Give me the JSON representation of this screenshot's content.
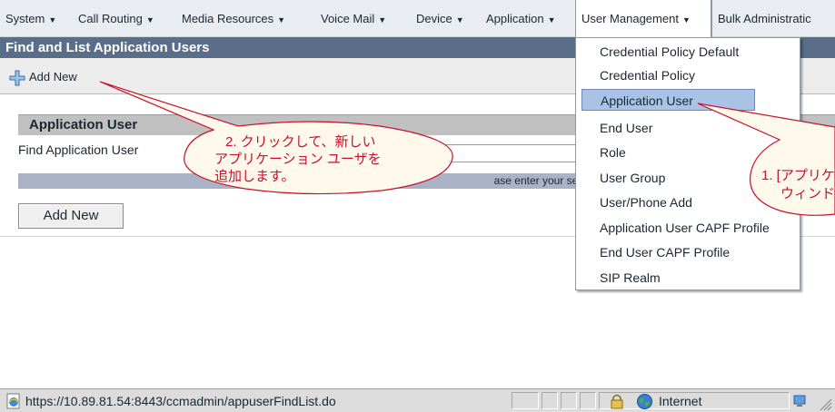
{
  "menubar": {
    "items": [
      {
        "label": "System"
      },
      {
        "label": "Call Routing"
      },
      {
        "label": "Media Resources"
      },
      {
        "label": "Voice Mail"
      },
      {
        "label": "Device"
      },
      {
        "label": "Application"
      },
      {
        "label": "User Management"
      },
      {
        "label": "Bulk Administratic"
      }
    ]
  },
  "page": {
    "title": "Find and List Application Users",
    "add_new_link": "Add New"
  },
  "section": {
    "header": "Application User",
    "find_label": "Find Application User",
    "hint_text": "ase enter your search c",
    "add_new_button": "Add New"
  },
  "dropdown": {
    "items": [
      {
        "label": "Credential Policy Default"
      },
      {
        "label": "Credential Policy"
      },
      {
        "label": "Application User"
      },
      {
        "label": "End User"
      },
      {
        "label": "Role"
      },
      {
        "label": "User Group"
      },
      {
        "label": "User/Phone Add"
      },
      {
        "label": "Application User CAPF Profile"
      },
      {
        "label": "End User CAPF Profile"
      },
      {
        "label": "SIP Realm"
      }
    ]
  },
  "callouts": {
    "left_line1": "2. クリックして、新しい",
    "left_line2": "アプリケーション ユーザを",
    "left_line3": "追加します。",
    "right_line1": "1. [アプリケ",
    "right_line2": "ウィンド"
  },
  "statusbar": {
    "url": "https://10.89.81.54:8443/ccmadmin/appuserFindList.do",
    "zone": "Internet"
  },
  "colors": {
    "title_bar": "#5a6d89",
    "menu_highlight": "#aac3e5",
    "callout_red": "#c8102e",
    "callout_fill": "#fff9ec"
  }
}
